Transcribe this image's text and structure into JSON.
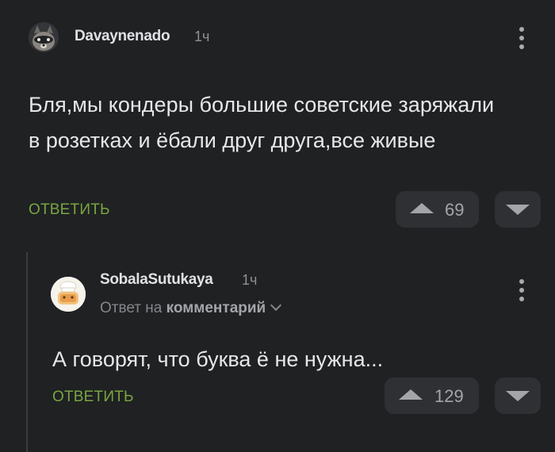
{
  "comments": [
    {
      "username": "Davaynenado",
      "time": "1ч",
      "text": "Бля,мы кондеры большие советские заряжали в розетках и ёбали друг друга,все живые",
      "reply_label": "ОТВЕТИТЬ",
      "rating": "69",
      "avatar_icon": "raccoon-avatar-icon"
    },
    {
      "username": "SobalaSutukaya",
      "time": "1ч",
      "reply_to_prefix": "Ответ на",
      "reply_to_target": "комментарий",
      "text": "А говорят, что буква ё не нужна...",
      "reply_label": "ОТВЕТИТЬ",
      "rating": "129",
      "avatar_icon": "chef-avatar-icon"
    }
  ],
  "colors": {
    "background": "#1f2123",
    "accent_green": "#7aa541",
    "text": "#e6e7e9",
    "muted": "#8e9094"
  }
}
